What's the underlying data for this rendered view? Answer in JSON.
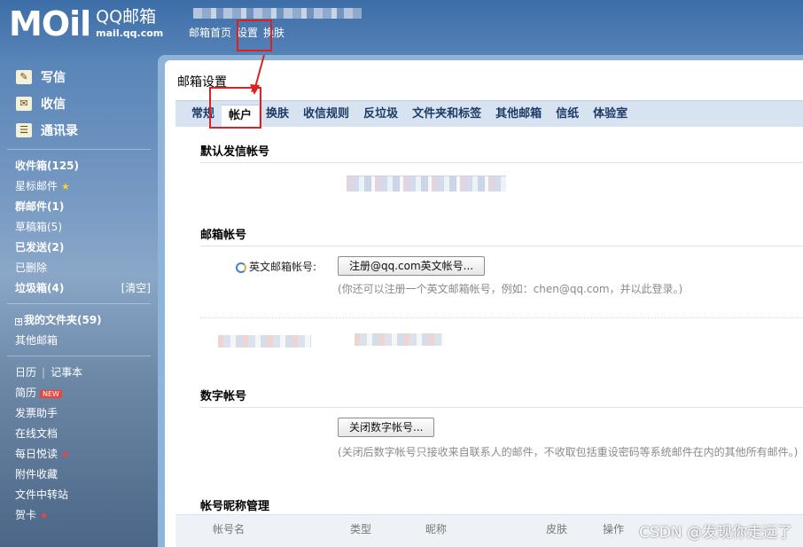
{
  "header": {
    "logo_main": "MOil",
    "logo_brand": "QQ邮箱",
    "logo_domain": "mail.qq.com",
    "nav": [
      "邮箱首页",
      "设置",
      "换肤"
    ]
  },
  "sidebar": {
    "actions": [
      {
        "label": "写信",
        "icon": "pencil-icon"
      },
      {
        "label": "收信",
        "icon": "inbox-icon"
      },
      {
        "label": "通讯录",
        "icon": "contacts-icon"
      }
    ],
    "folders": [
      {
        "label": "收件箱(125)",
        "bold": true
      },
      {
        "label": "星标邮件",
        "star": true
      },
      {
        "label": "群邮件(1)",
        "bold": true
      },
      {
        "label": "草稿箱(5)"
      },
      {
        "label": "已发送(2)",
        "bold": true
      },
      {
        "label": "已删除"
      },
      {
        "label": "垃圾箱(4)",
        "bold": true,
        "action": "[清空]"
      }
    ],
    "my_folders": "我的文件夹(59)",
    "other_mailbox": "其他邮箱",
    "calendar": "日历",
    "notes": "记事本",
    "apps": [
      {
        "label": "简历",
        "badge": "NEW"
      },
      {
        "label": "发票助手"
      },
      {
        "label": "在线文档"
      },
      {
        "label": "每日悦读",
        "dot": true
      },
      {
        "label": "附件收藏"
      },
      {
        "label": "文件中转站"
      },
      {
        "label": "贺卡",
        "dot": true
      }
    ]
  },
  "panel": {
    "title": "邮箱设置",
    "tabs": [
      "常规",
      "帐户",
      "换肤",
      "收信规则",
      "反垃圾",
      "文件夹和标签",
      "其他邮箱",
      "信纸",
      "体验室"
    ],
    "active_tab": "帐户"
  },
  "sections": {
    "default_sender": "默认发信帐号",
    "mail_account": "邮箱帐号",
    "english_label": "英文邮箱帐号:",
    "register_btn": "注册@qq.com英文帐号...",
    "register_hint": "(你还可以注册一个英文邮箱帐号，例如：chen@qq.com，并以此登录。)",
    "digital_account": "数字帐号",
    "close_digital_btn": "关闭数字帐号...",
    "close_digital_hint": "(关闭后数字帐号只接收来自联系人的邮件，不收取包括重设密码等系统邮件在内的其他所有邮件。)",
    "nickname_mgmt": "帐号昵称管理",
    "nickname_columns": [
      "帐号名",
      "类型",
      "昵称",
      "皮肤",
      "操作"
    ]
  },
  "watermark": "CSDN @发现你走远了",
  "colors": {
    "highlight": "#e02020",
    "link": "#1e3a66"
  }
}
